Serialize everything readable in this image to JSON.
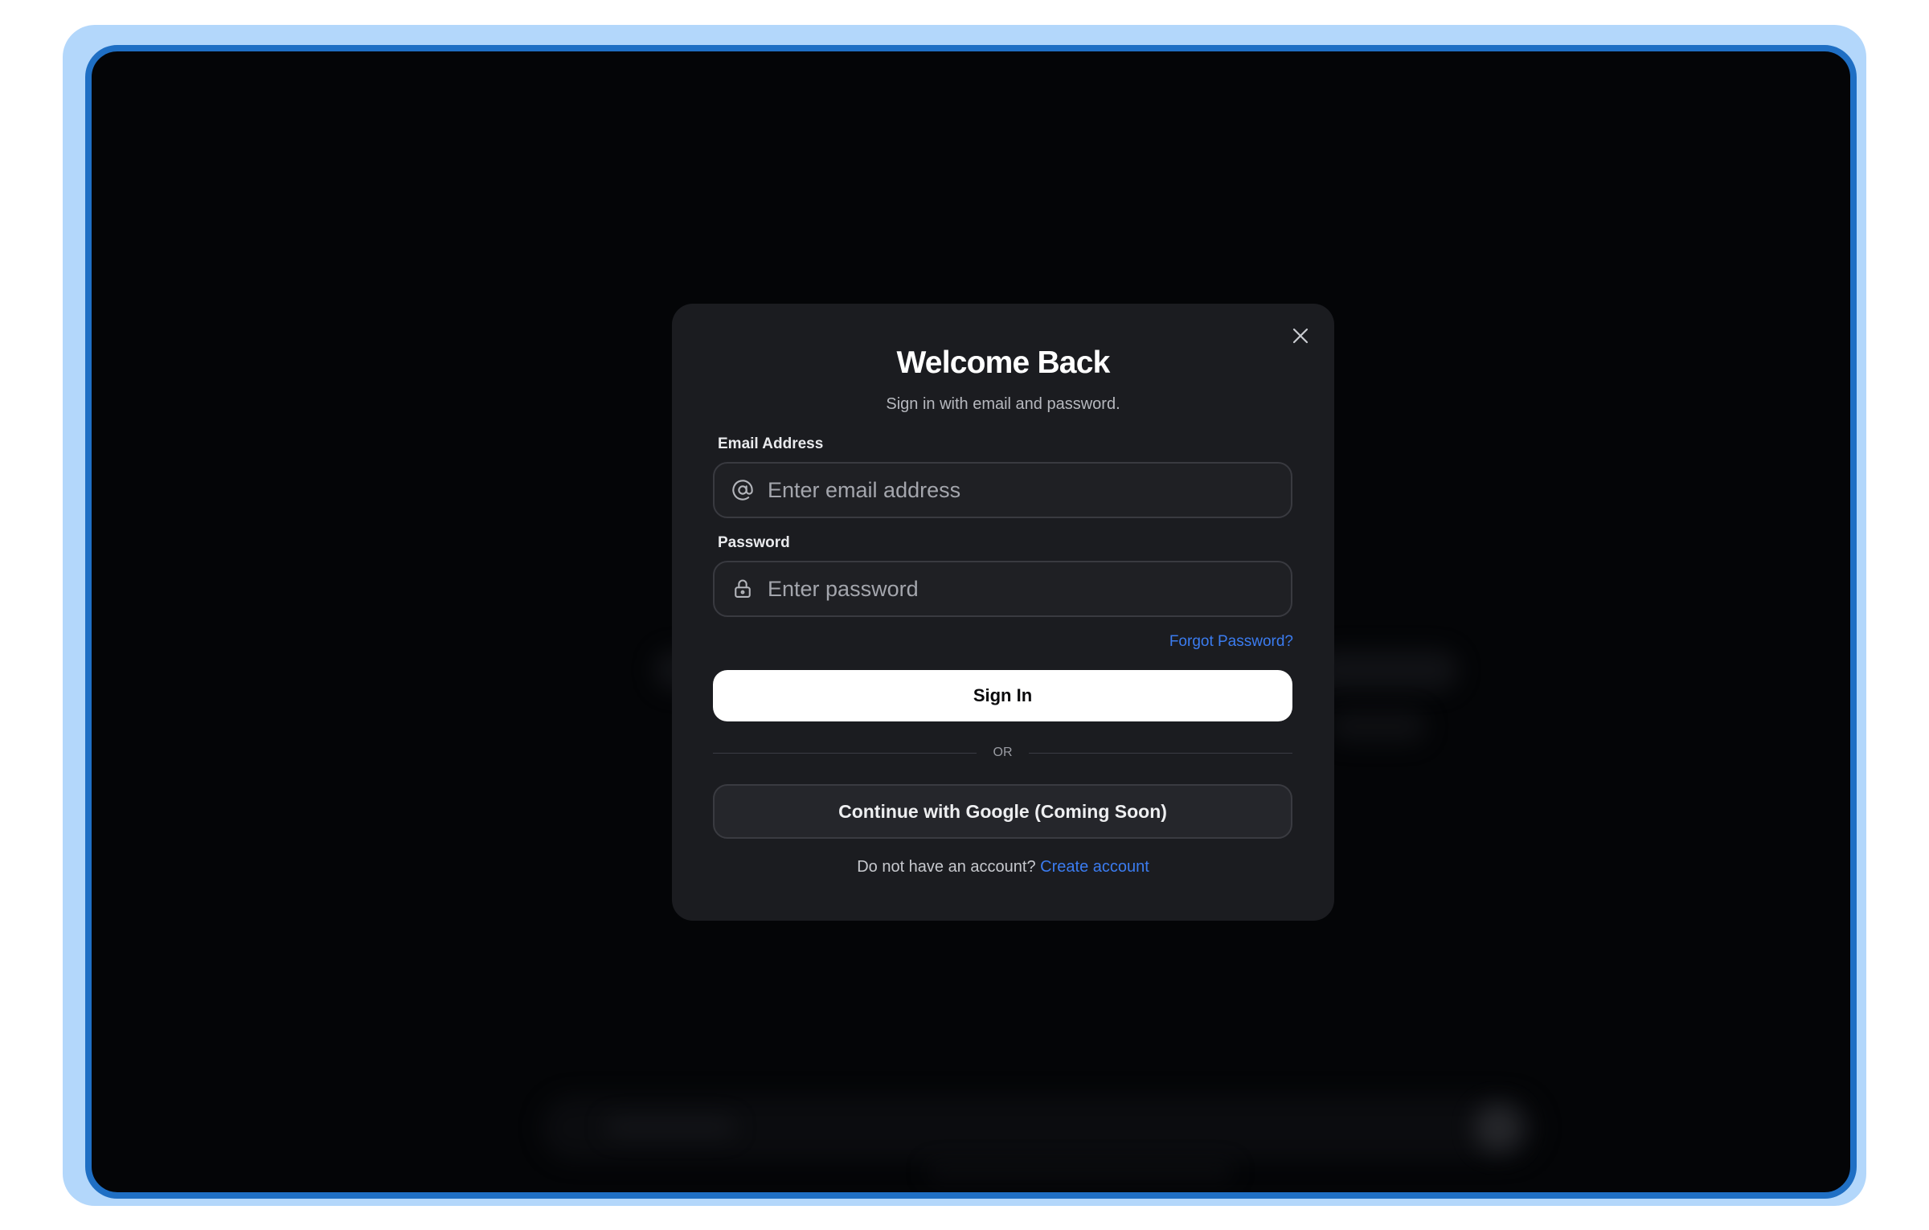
{
  "modal": {
    "title": "Welcome Back",
    "subtitle": "Sign in with email and password.",
    "close_icon": "close-icon"
  },
  "email": {
    "label": "Email Address",
    "placeholder": "Enter email address",
    "value": "",
    "icon": "at-sign-icon"
  },
  "password": {
    "label": "Password",
    "placeholder": "Enter password",
    "value": "",
    "icon": "lock-icon"
  },
  "forgot_password": "Forgot Password?",
  "signin_label": "Sign In",
  "divider_text": "OR",
  "google_label": "Continue with Google (Coming Soon)",
  "signup": {
    "prompt": "Do not have an account?",
    "link": "Create account"
  },
  "colors": {
    "accent_link": "#3b7cf0",
    "modal_bg": "#1b1c20",
    "frame_blue": "#1f6fc4",
    "frame_outer": "#b3d7fb"
  }
}
